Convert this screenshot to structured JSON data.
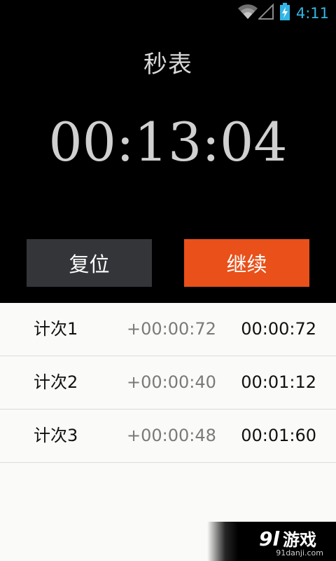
{
  "status_bar": {
    "time": "4:11",
    "icons": [
      "wifi-icon",
      "signal-icon",
      "battery-charging-icon"
    ],
    "accent_color": "#33b5e5"
  },
  "stopwatch": {
    "title": "秒表",
    "elapsed": "00:13:04"
  },
  "buttons": {
    "reset_label": "复位",
    "continue_label": "继续",
    "reset_color": "#333538",
    "continue_color": "#e9501a"
  },
  "laps": [
    {
      "label": "计次1",
      "delta": "+00:00:72",
      "total": "00:00:72"
    },
    {
      "label": "计次2",
      "delta": "+00:00:40",
      "total": "00:01:12"
    },
    {
      "label": "计次3",
      "delta": "+00:00:48",
      "total": "00:01:60"
    }
  ],
  "watermark": {
    "logo_icon": "91youxi-logo-icon",
    "url": "91danji.com"
  }
}
